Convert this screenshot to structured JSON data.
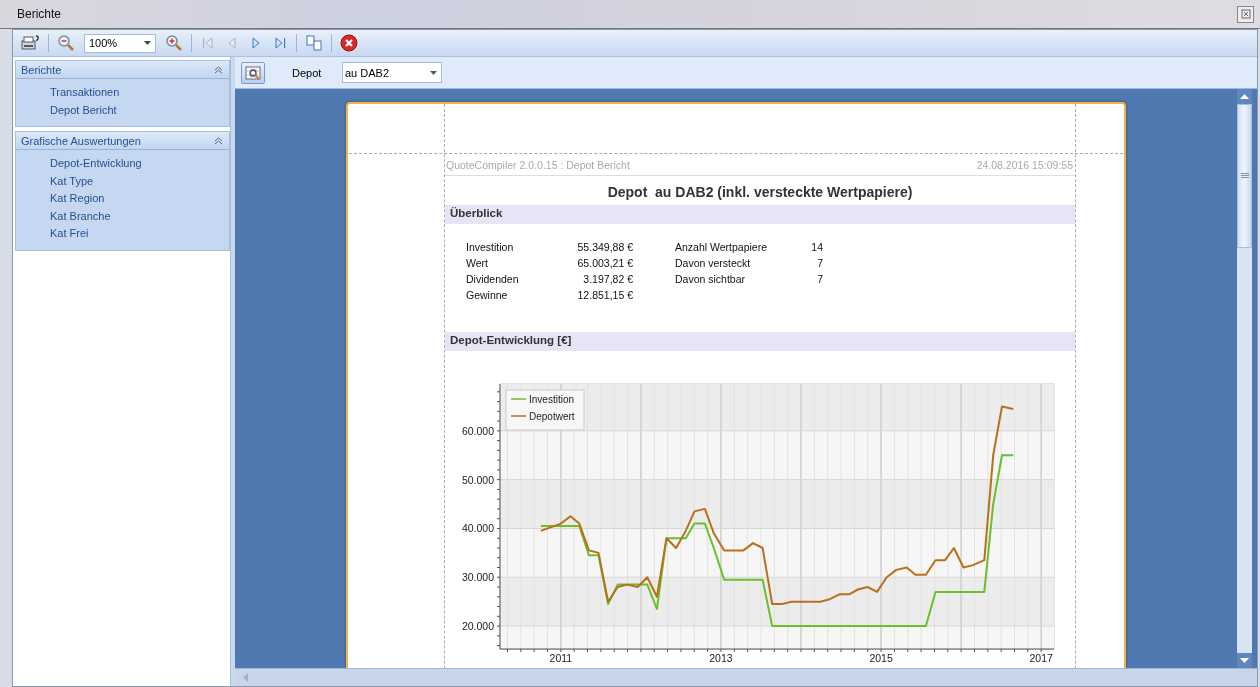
{
  "window": {
    "title": "Berichte"
  },
  "toolbar": {
    "zoom": "100%",
    "nav": [
      {
        "kind": "first",
        "disabled": true
      },
      {
        "kind": "prev",
        "disabled": true
      },
      {
        "kind": "next",
        "disabled": false
      },
      {
        "kind": "last",
        "disabled": false
      }
    ]
  },
  "sidebar": {
    "groups": [
      {
        "title": "Berichte",
        "expanded": true,
        "items": [
          "Transaktionen",
          "Depot Bericht"
        ]
      },
      {
        "title": "Grafische Auswertungen",
        "expanded": true,
        "items": [
          "Depot-Entwicklung",
          "Kat Type",
          "Kat Region",
          "Kat Branche",
          "Kat Frei"
        ]
      }
    ]
  },
  "filter": {
    "label": "Depot",
    "value": "au DAB2"
  },
  "report": {
    "header_left": "QuoteCompiler 2.0.0.15 : Depot Bericht",
    "header_right": "24.08.2016 15:09:55",
    "title": "Depot  au DAB2 (inkl. versteckte Wertpapiere)",
    "overview": {
      "heading": "Überblick",
      "left": [
        {
          "label": "Investition",
          "value": "55.349,88 €"
        },
        {
          "label": "Wert",
          "value": "65.003,21 €"
        },
        {
          "label": "Dividenden",
          "value": "3.197,82 €"
        },
        {
          "label": "Gewinne",
          "value": "12.851,15 €"
        }
      ],
      "right": [
        {
          "label": "Anzahl Wertpapiere",
          "value": "14"
        },
        {
          "label": "Davon versteckt",
          "value": "7"
        },
        {
          "label": "Davon sichtbar",
          "value": "7"
        }
      ]
    },
    "development": {
      "heading": "Depot-Entwicklung [€]",
      "chart_data": {
        "type": "line",
        "x": [
          2010.75,
          2011.0,
          2011.12,
          2011.23,
          2011.35,
          2011.47,
          2011.59,
          2011.71,
          2011.83,
          2011.96,
          2012.08,
          2012.2,
          2012.32,
          2012.44,
          2012.56,
          2012.67,
          2012.8,
          2012.91,
          2013.04,
          2013.15,
          2013.28,
          2013.4,
          2013.52,
          2013.64,
          2013.76,
          2013.88,
          2014.0,
          2014.12,
          2014.24,
          2014.36,
          2014.48,
          2014.6,
          2014.71,
          2014.83,
          2014.95,
          2015.07,
          2015.19,
          2015.32,
          2015.43,
          2015.56,
          2015.68,
          2015.8,
          2015.91,
          2016.03,
          2016.15,
          2016.29,
          2016.4,
          2016.51,
          2016.65
        ],
        "series": [
          {
            "name": "Investition",
            "color": "#6cbf2a",
            "values": [
              40500,
              40500,
              40500,
              40500,
              34500,
              34500,
              24500,
              28500,
              28500,
              28500,
              28500,
              23500,
              38000,
              38000,
              38000,
              41000,
              41000,
              36000,
              29500,
              29500,
              29500,
              29500,
              29500,
              20000,
              20000,
              20000,
              20000,
              20000,
              20000,
              20000,
              20000,
              20000,
              20000,
              20000,
              20000,
              20000,
              20000,
              20000,
              20000,
              20000,
              27000,
              27000,
              27000,
              27000,
              27000,
              27000,
              45000,
              55000,
              55000
            ]
          },
          {
            "name": "Depotwert",
            "color": "#b8701a",
            "values": [
              39500,
              41000,
              42500,
              41000,
              35500,
              35000,
              25000,
              28000,
              28500,
              28000,
              30000,
              26000,
              38000,
              36000,
              39500,
              43500,
              44000,
              39000,
              35500,
              35500,
              35500,
              37000,
              36000,
              24500,
              24500,
              25000,
              25000,
              25000,
              25000,
              25500,
              26500,
              26500,
              27500,
              28000,
              27000,
              30000,
              31500,
              32000,
              30500,
              30500,
              33500,
              33500,
              36000,
              32000,
              32500,
              33500,
              55000,
              65000,
              64500
            ]
          }
        ],
        "grid": true,
        "legend": true,
        "xlim": [
          2010.24,
          2017.16
        ],
        "ylim": [
          15300,
          69600
        ],
        "xticks": [
          {
            "value": 2011,
            "label": "2011"
          },
          {
            "value": 2013,
            "label": "2013"
          },
          {
            "value": 2015,
            "label": "2015"
          },
          {
            "value": 2017,
            "label": "2017"
          }
        ],
        "yticks": [
          {
            "value": 20000,
            "label": "20.000"
          },
          {
            "value": 30000,
            "label": "30.000"
          },
          {
            "value": 40000,
            "label": "40.000"
          },
          {
            "value": 50000,
            "label": "50.000"
          },
          {
            "value": 60000,
            "label": "60.000"
          }
        ]
      }
    }
  }
}
